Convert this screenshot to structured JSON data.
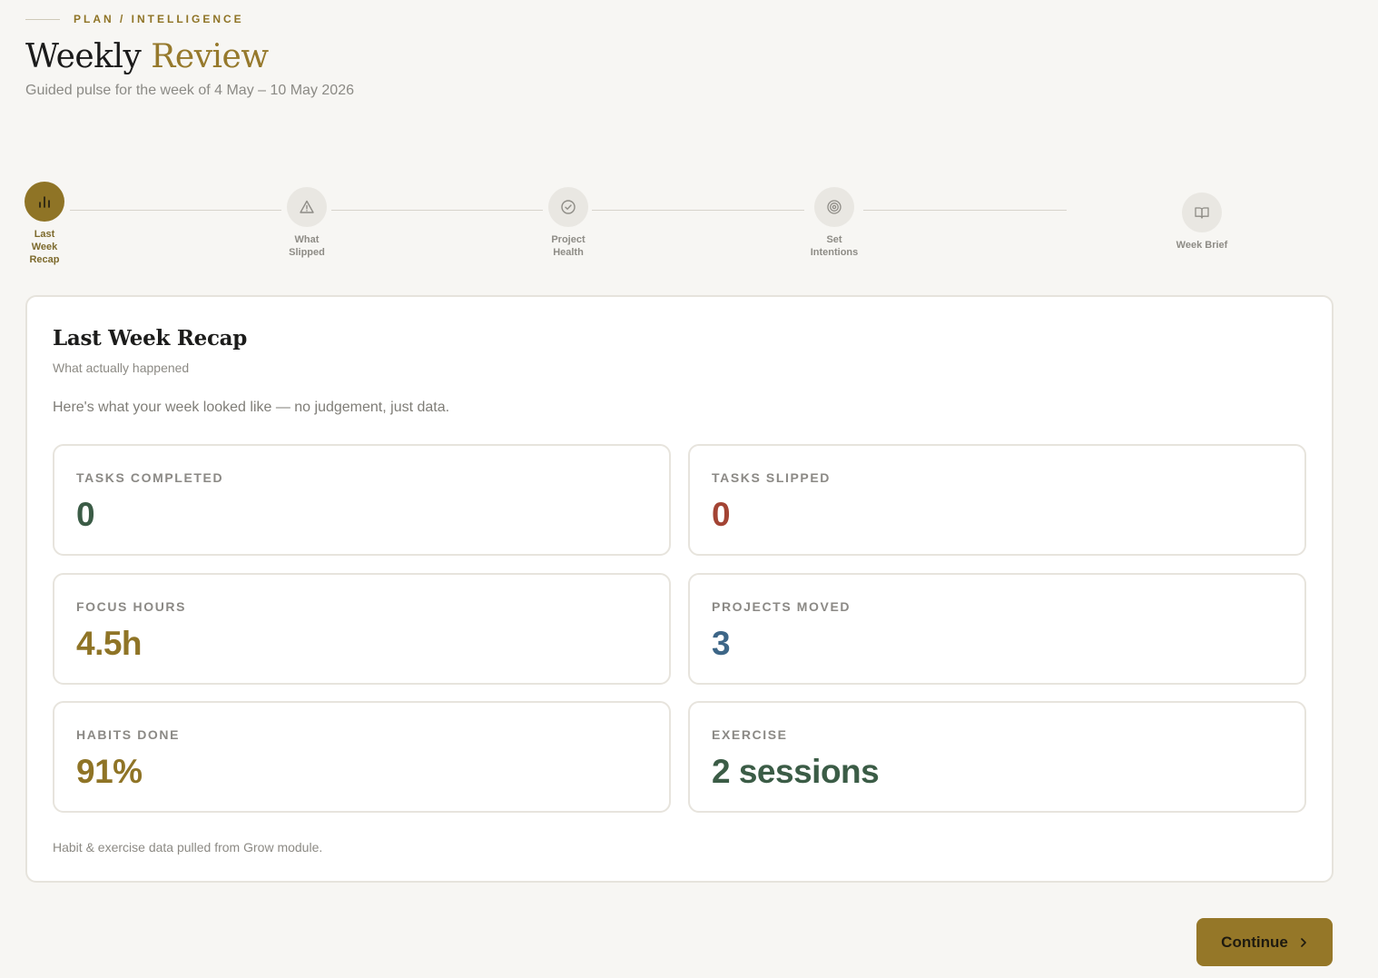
{
  "header": {
    "eyebrow": "PLAN / INTELLIGENCE",
    "title_main": "Weekly",
    "title_accent": "Review",
    "subtitle": "Guided pulse for the week of 4 May – 10 May 2026"
  },
  "stepper": {
    "steps": [
      {
        "label": "Last Week Recap",
        "icon": "bar-chart-icon",
        "active": true
      },
      {
        "label": "What Slipped",
        "icon": "warning-triangle-icon",
        "active": false
      },
      {
        "label": "Project Health",
        "icon": "check-circle-icon",
        "active": false
      },
      {
        "label": "Set Intentions",
        "icon": "target-icon",
        "active": false
      },
      {
        "label": "Week Brief",
        "icon": "book-open-icon",
        "active": false
      }
    ]
  },
  "card": {
    "title": "Last Week Recap",
    "subtitle": "What actually happened",
    "intro": "Here's what your week looked like — no judgement, just data.",
    "footnote": "Habit & exercise data pulled from Grow module."
  },
  "stats": [
    {
      "label": "TASKS COMPLETED",
      "value": "0",
      "color": "#3b5c46"
    },
    {
      "label": "TASKS SLIPPED",
      "value": "0",
      "color": "#a34434"
    },
    {
      "label": "FOCUS HOURS",
      "value": "4.5h",
      "color": "#8f7426"
    },
    {
      "label": "PROJECTS MOVED",
      "value": "3",
      "color": "#3d6687"
    },
    {
      "label": "HABITS DONE",
      "value": "91%",
      "color": "#8f7426"
    },
    {
      "label": "EXERCISE",
      "value": "2 sessions",
      "color": "#3b5c46"
    }
  ],
  "actions": {
    "continue_label": "Continue"
  },
  "colors": {
    "accent": "#8f7426",
    "background": "#f7f6f3",
    "inactive_step": "#e9e7e2"
  }
}
